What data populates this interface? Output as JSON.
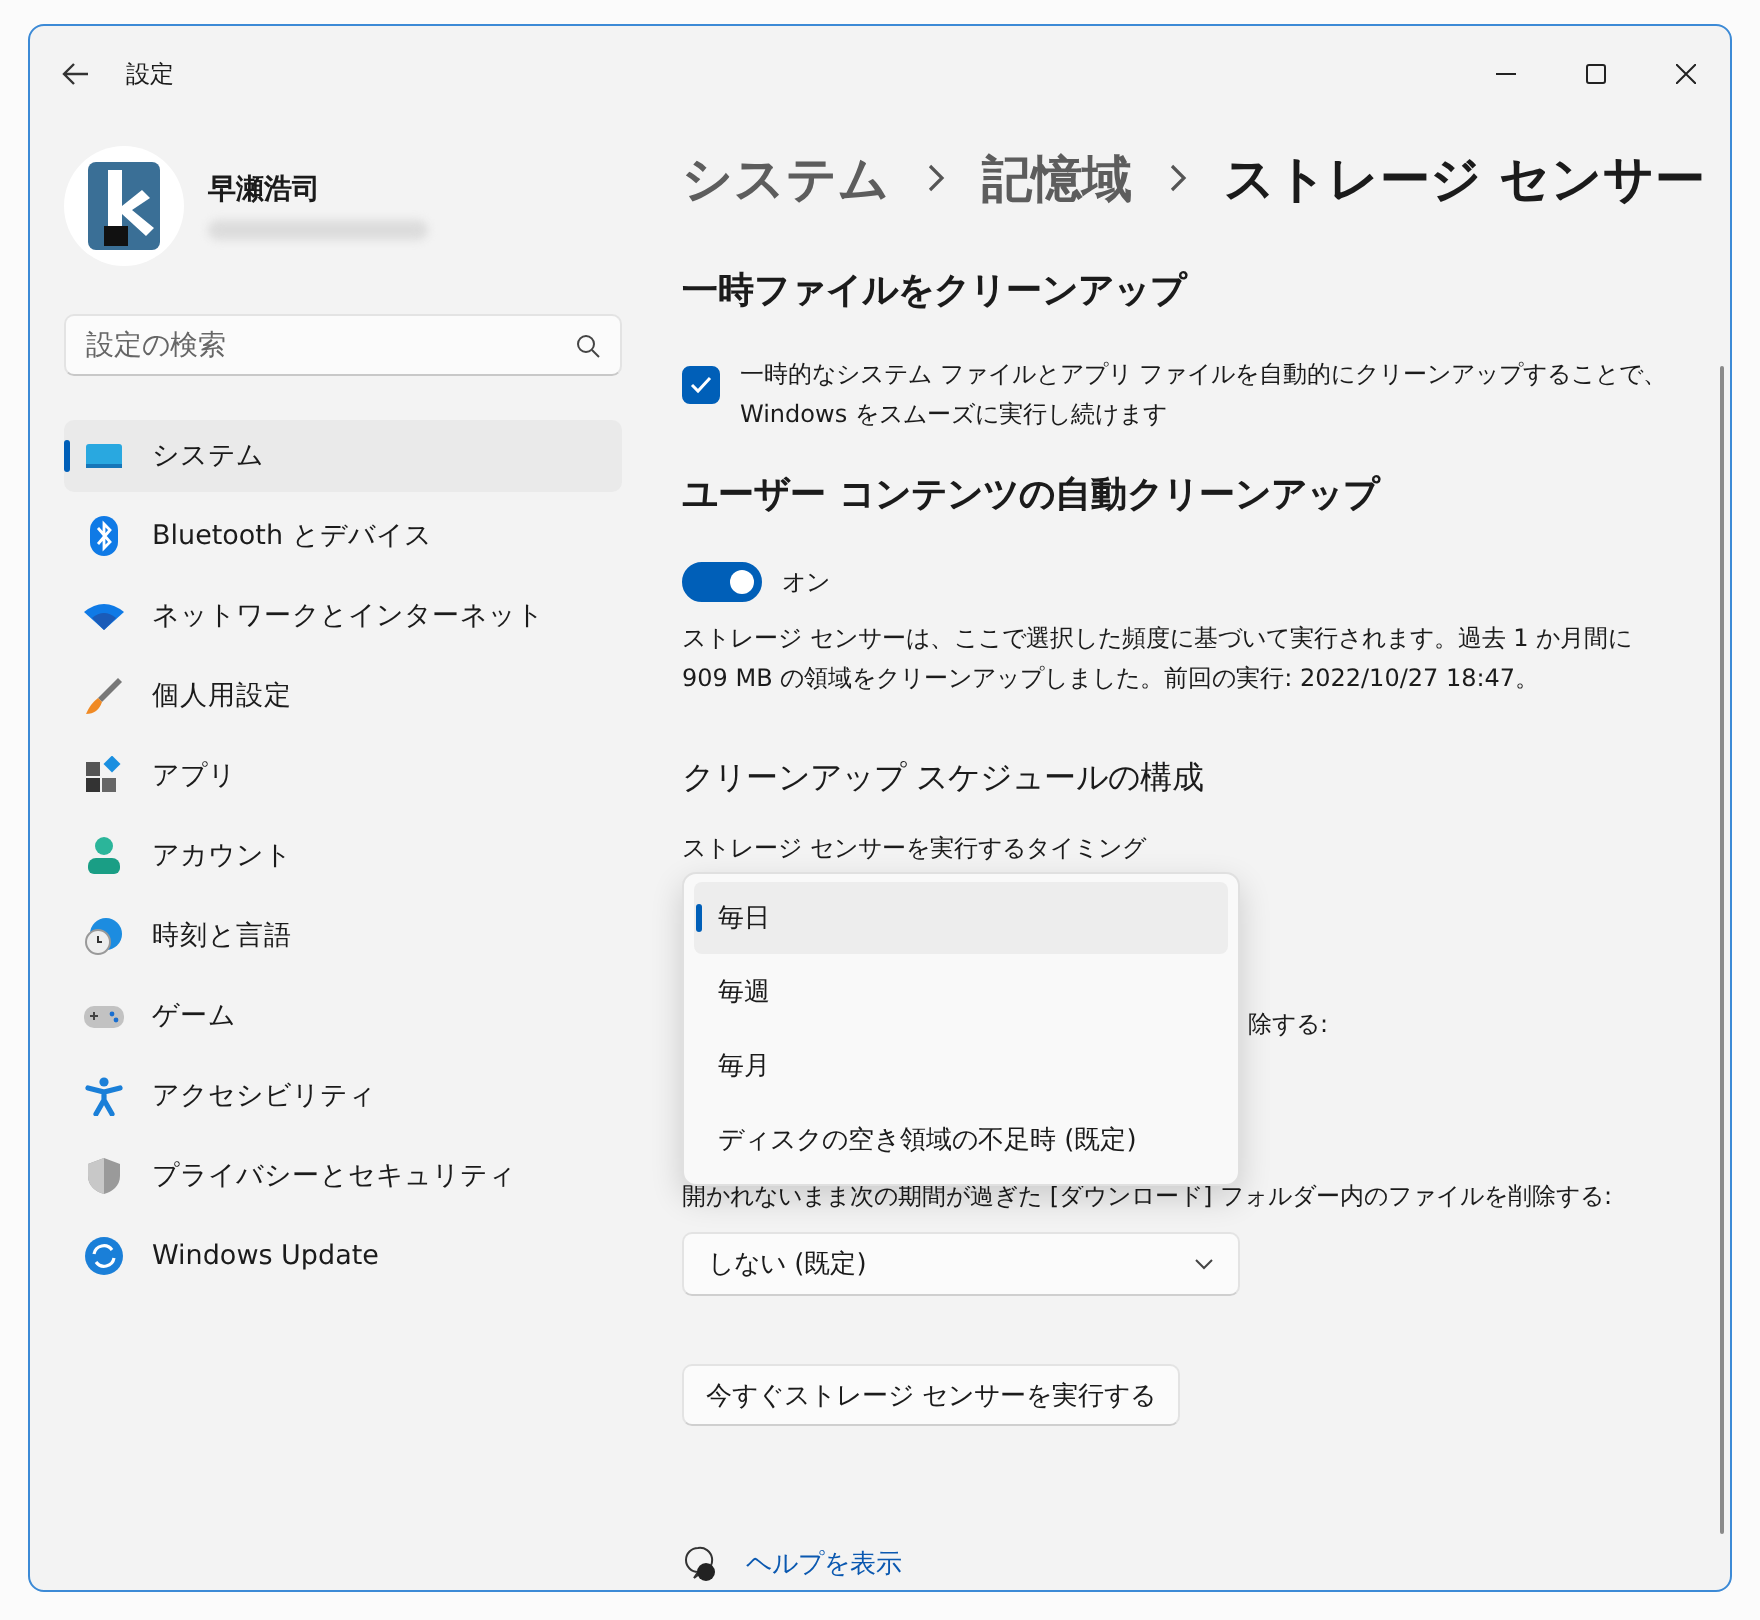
{
  "window": {
    "title": "設定"
  },
  "user": {
    "name": "早瀬浩司"
  },
  "search": {
    "placeholder": "設定の検索"
  },
  "nav": [
    {
      "label": "システム",
      "kind": "system",
      "selected": true
    },
    {
      "label": "Bluetooth とデバイス",
      "kind": "bluetooth",
      "selected": false
    },
    {
      "label": "ネットワークとインターネット",
      "kind": "network",
      "selected": false
    },
    {
      "label": "個人用設定",
      "kind": "brush",
      "selected": false
    },
    {
      "label": "アプリ",
      "kind": "apps",
      "selected": false
    },
    {
      "label": "アカウント",
      "kind": "account",
      "selected": false
    },
    {
      "label": "時刻と言語",
      "kind": "time",
      "selected": false
    },
    {
      "label": "ゲーム",
      "kind": "game",
      "selected": false
    },
    {
      "label": "アクセシビリティ",
      "kind": "accessibility",
      "selected": false
    },
    {
      "label": "プライバシーとセキュリティ",
      "kind": "shield",
      "selected": false
    },
    {
      "label": "Windows Update",
      "kind": "update",
      "selected": false
    }
  ],
  "breadcrumb": [
    "システム",
    "記憶域",
    "ストレージ センサー"
  ],
  "temp_cleanup": {
    "heading": "一時ファイルをクリーンアップ",
    "checked": true,
    "label": "一時的なシステム ファイルとアプリ ファイルを自動的にクリーンアップすることで、Windows をスムーズに実行し続けます"
  },
  "auto_cleanup": {
    "heading": "ユーザー コンテンツの自動クリーンアップ",
    "on": true,
    "state_label": "オン",
    "description": "ストレージ センサーは、ここで選択した頻度に基づいて実行されます。過去 1 か月間に 909 MB の領域をクリーンアップしました。前回の実行: 2022/10/27 18:47。"
  },
  "schedule": {
    "heading": "クリーンアップ スケジュールの構成",
    "timing_label": "ストレージ センサーを実行するタイミング",
    "timing_options": [
      {
        "label": "毎日",
        "selected": true
      },
      {
        "label": "毎週",
        "selected": false
      },
      {
        "label": "毎月",
        "selected": false
      },
      {
        "label": "ディスクの空き領域の不足時 (既定)",
        "selected": false
      }
    ],
    "recycle_label_visible": "除する:",
    "downloads_label": "開かれないまま次の期間が過ぎた [ダウンロード] フォルダー内のファイルを削除する:",
    "downloads_value": "しない (既定)"
  },
  "run_button": "今すぐストレージ センサーを実行する",
  "help_link": "ヘルプを表示"
}
